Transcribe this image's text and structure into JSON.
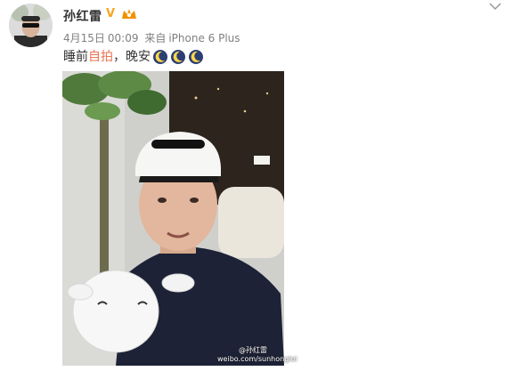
{
  "post": {
    "author": "孙红雷",
    "date": "4月15日",
    "time": "00:09",
    "source_prefix": "来自",
    "source_device": "iPhone 6 Plus",
    "text_before": "睡前",
    "hashtag": "自拍",
    "text_after": "，晚安"
  },
  "photo": {
    "watermark_handle": "@孙红雷",
    "watermark_url": "weibo.com/sunhonglei"
  },
  "icons": {
    "verified": "V",
    "verified_name": "verified-badge-icon",
    "member_name": "member-crown-icon",
    "emoji_name": "moon-goodnight-emoji-icon",
    "more_name": "chevron-down-icon"
  },
  "colors": {
    "hashtag": "#eb7350",
    "verified": "#f5a623",
    "text": "#333333",
    "meta": "#808080"
  }
}
